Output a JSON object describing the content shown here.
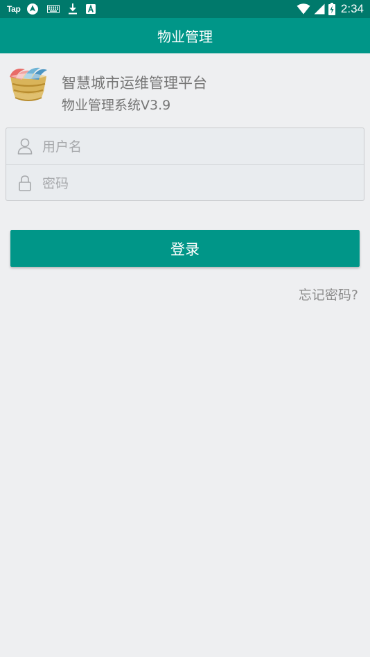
{
  "status_bar": {
    "left_text": "Tap",
    "time": "2:34",
    "icons_left": [
      "navigation-icon",
      "keyboard-icon",
      "download-icon",
      "a-box-icon"
    ],
    "icons_right": [
      "wifi-icon",
      "signal-icon",
      "battery-charging-icon"
    ]
  },
  "toolbar": {
    "title": "物业管理"
  },
  "brand": {
    "title": "智慧城市运维管理平台",
    "subtitle": "物业管理系统V3.9",
    "logo_icon": "city-platform-logo-icon"
  },
  "login_form": {
    "username_placeholder": "用户名",
    "username_value": "",
    "password_placeholder": "密码",
    "password_value": "",
    "username_icon": "person-icon",
    "password_icon": "lock-icon"
  },
  "login_button_label": "登录",
  "forgot_password_label": "忘记密码?",
  "colors": {
    "status_bar": "#00796b",
    "toolbar": "#009688",
    "accent": "#009688",
    "background": "#eeeff1",
    "field_background": "#e9ecef",
    "text_muted": "#757575"
  }
}
